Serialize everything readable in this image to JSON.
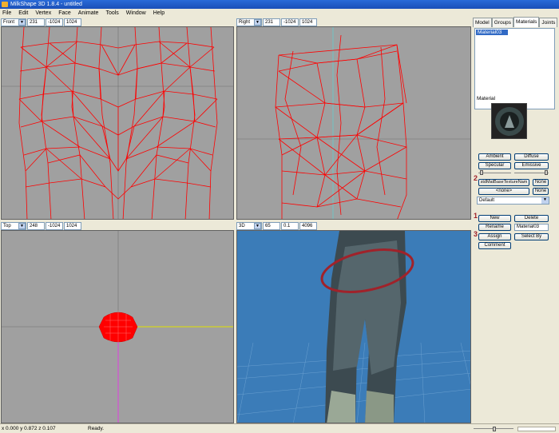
{
  "window": {
    "title": "MilkShape 3D 1.8.4 - untitled"
  },
  "menu": [
    "File",
    "Edit",
    "Vertex",
    "Face",
    "Animate",
    "Tools",
    "Window",
    "Help"
  ],
  "viewports": {
    "front": {
      "mode": "Front",
      "zoom": "231",
      "near": "-1024",
      "far": "1024"
    },
    "right": {
      "mode": "Right",
      "zoom": "231",
      "near": "-1024",
      "far": "1024"
    },
    "top": {
      "mode": "Top",
      "zoom": "248",
      "near": "-1024",
      "far": "1024"
    },
    "persp": {
      "mode": "3D",
      "fov": "65",
      "near": "0.1",
      "far": "4096"
    }
  },
  "panel": {
    "tabs": [
      "Model",
      "Groups",
      "Materials",
      "Joints"
    ],
    "active_tab": "Materials",
    "materials": [
      "Material03"
    ],
    "material_label": "Material",
    "buttons": {
      "ambient": "Ambient",
      "diffuse": "Diffuse",
      "specular": "Specular",
      "emissive": "Emissive",
      "texture": "stdMatBaseTextureNam",
      "texture_none": "None",
      "alpha": "<none>",
      "alpha_none": "None",
      "new": "New",
      "delete": "Delete",
      "rename": "Rename",
      "assign": "Assign",
      "select_by": "Select By",
      "comment": "Comment"
    },
    "mode_select": "Default",
    "name_field": "Material03",
    "step_numbers": [
      "2",
      "1",
      "3"
    ]
  },
  "status": {
    "coords": "x 0.000 y 0.872 z 0.107",
    "text": "Ready."
  },
  "colors": {
    "viewport_bg": "#a0a0a0",
    "wireframe": "#ff0000",
    "persp_bg": "#3b7cb8",
    "selection": "#316ac5",
    "annotation": "#a0222a"
  }
}
